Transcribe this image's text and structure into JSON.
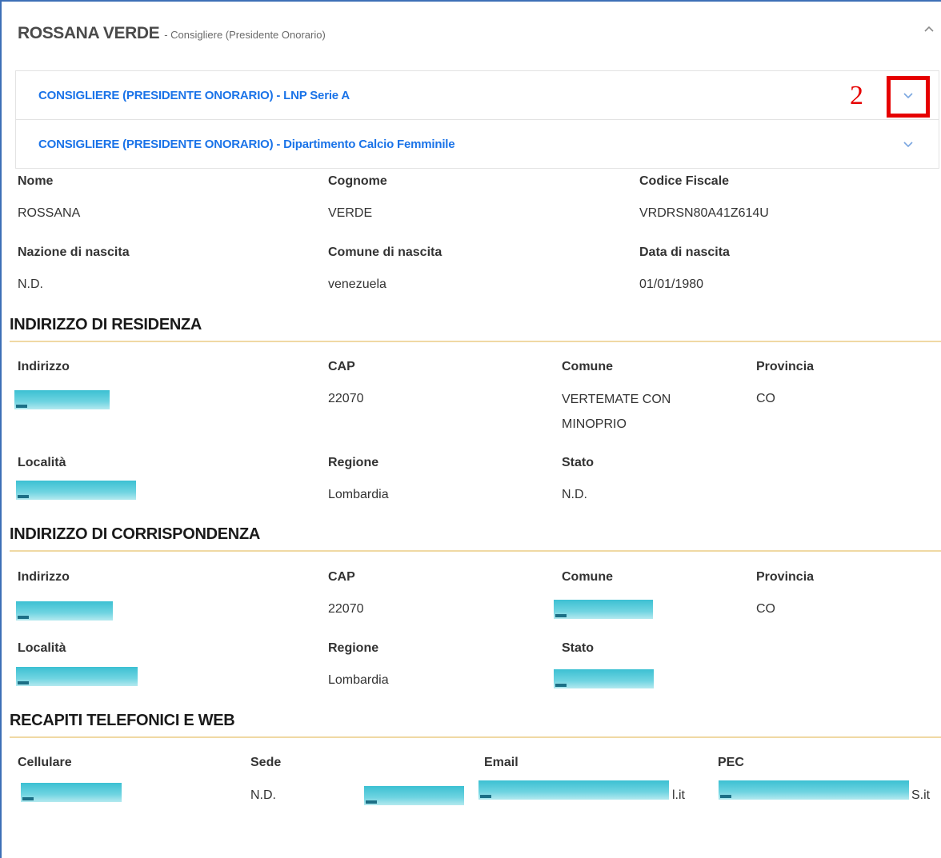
{
  "header": {
    "name": "ROSSANA VERDE",
    "role": "- Consigliere (Presidente Onorario)"
  },
  "accordions": [
    {
      "label": "CONSIGLIERE (PRESIDENTE ONORARIO) - LNP Serie A"
    },
    {
      "label": "CONSIGLIERE (PRESIDENTE ONORARIO) - Dipartimento Calcio Femminile"
    }
  ],
  "annotation": {
    "number": "2",
    "color": "#e60000"
  },
  "personal": {
    "nome_label": "Nome",
    "nome": "ROSSANA",
    "cognome_label": "Cognome",
    "cognome": "VERDE",
    "cf_label": "Codice Fiscale",
    "cf": "VRDRSN80A41Z614U",
    "nazione_label": "Nazione di nascita",
    "nazione": "N.D.",
    "comune_label": "Comune di nascita",
    "comune": "venezuela",
    "data_label": "Data di nascita",
    "data": "01/01/1980"
  },
  "residenza": {
    "title": "INDIRIZZO DI RESIDENZA",
    "indirizzo_label": "Indirizzo",
    "cap_label": "CAP",
    "cap": "22070",
    "comune_label": "Comune",
    "comune": "VERTEMATE CON MINOPRIO",
    "provincia_label": "Provincia",
    "provincia": "CO",
    "localita_label": "Località",
    "regione_label": "Regione",
    "regione": "Lombardia",
    "stato_label": "Stato",
    "stato": "N.D."
  },
  "corrispondenza": {
    "title": "INDIRIZZO DI CORRISPONDENZA",
    "indirizzo_label": "Indirizzo",
    "cap_label": "CAP",
    "cap": "22070",
    "comune_label": "Comune",
    "provincia_label": "Provincia",
    "provincia": "CO",
    "localita_label": "Località",
    "regione_label": "Regione",
    "regione": "Lombardia",
    "stato_label": "Stato"
  },
  "recapiti": {
    "title": "RECAPITI TELEFONICI E WEB",
    "cellulare_label": "Cellulare",
    "sede_label": "Sede",
    "sede": "N.D.",
    "email_label": "Email",
    "email_suffix": "l.it",
    "pec_label": "PEC",
    "pec_suffix": "S.it"
  },
  "colors": {
    "accent": "#1a73e8",
    "section_rule": "#f0d9a4",
    "redaction": "#3cc0d2"
  }
}
